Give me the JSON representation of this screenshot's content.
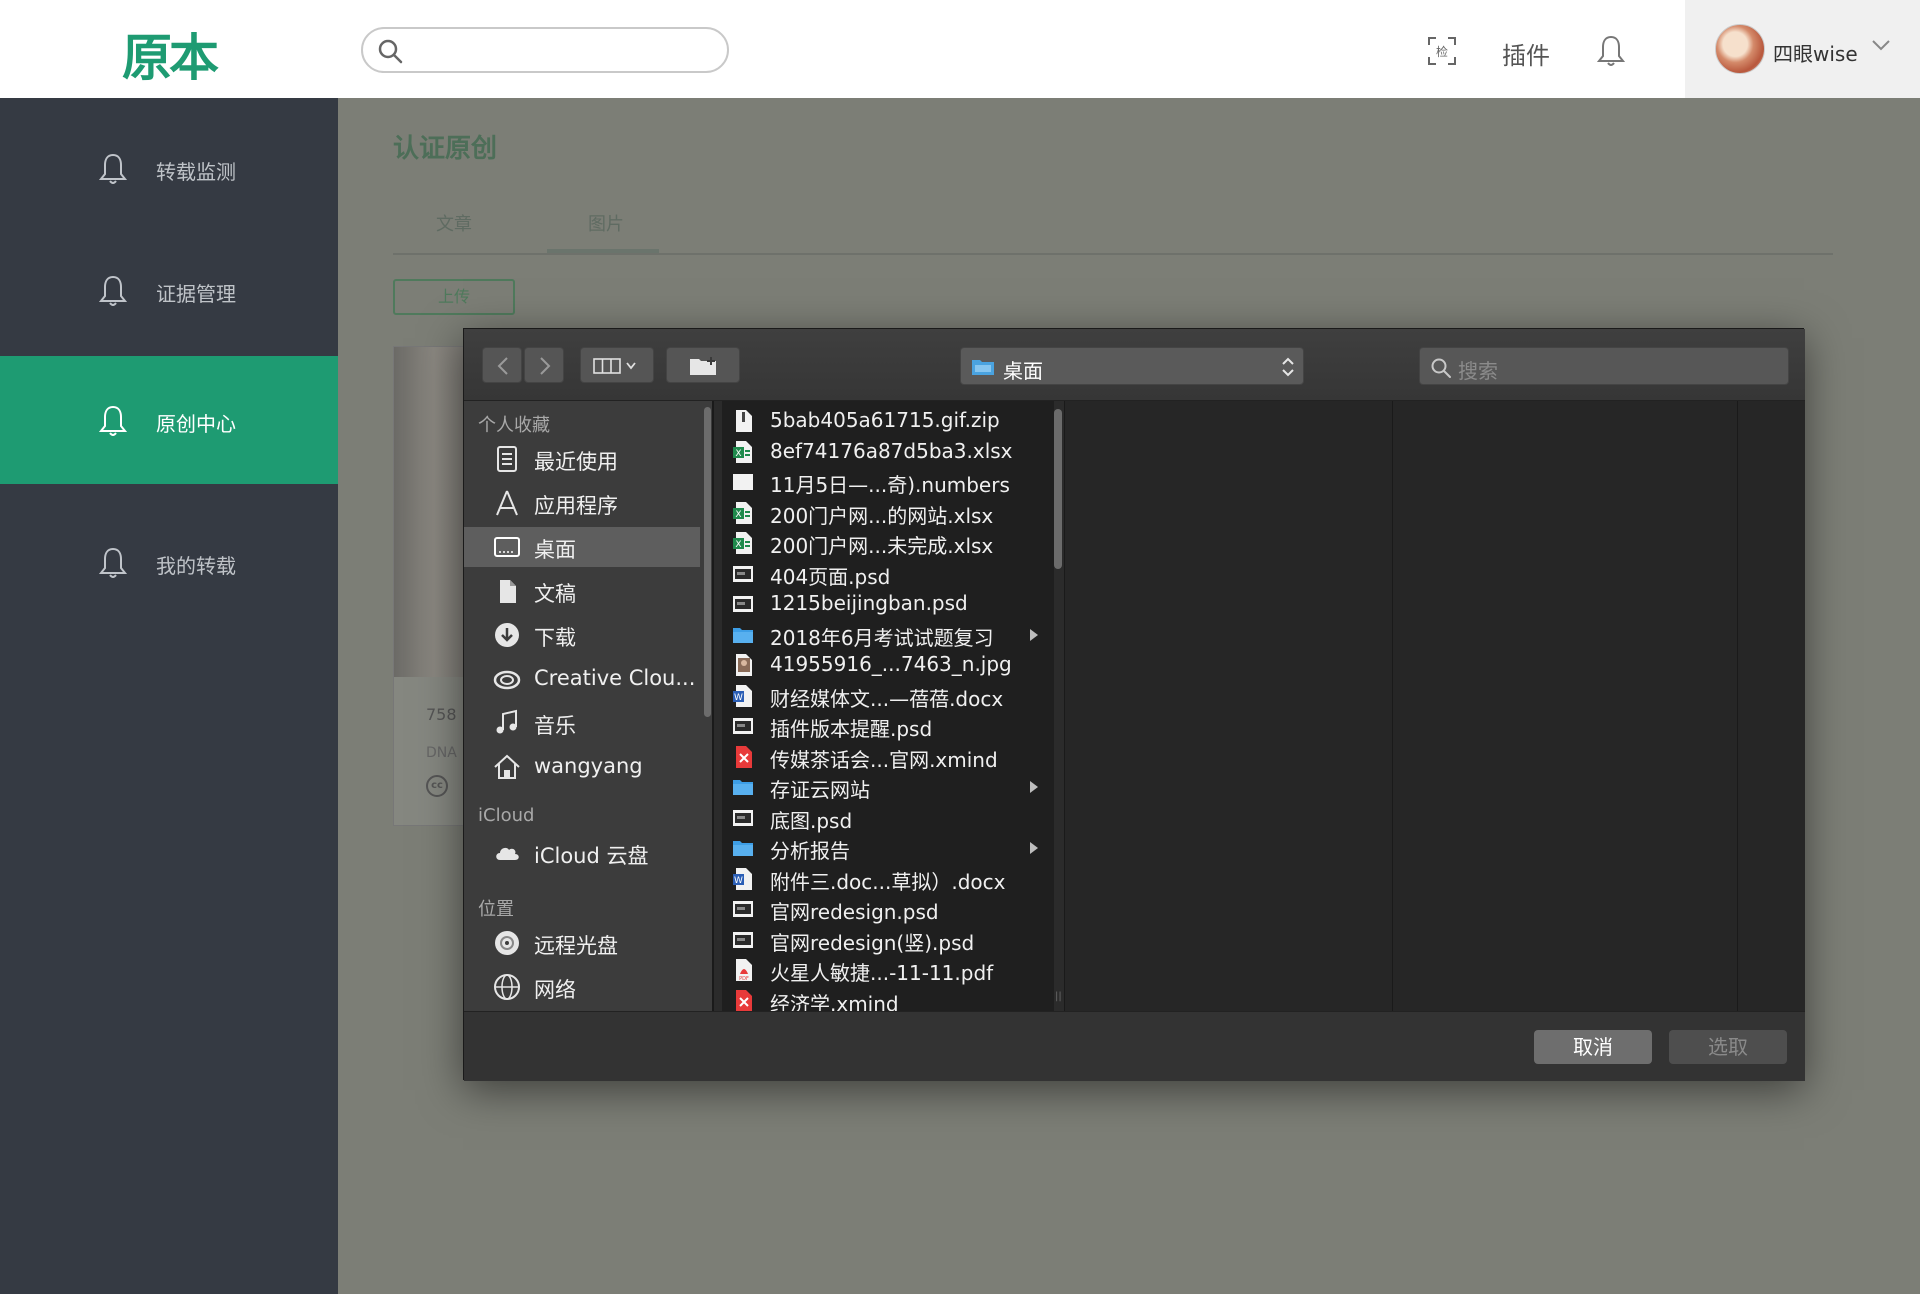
{
  "header": {
    "logo": "原本",
    "search_placeholder": "",
    "plugin_label": "插件",
    "user_name": "四眼wise"
  },
  "sidebar": {
    "items": [
      {
        "label": "转载监测"
      },
      {
        "label": "证据管理"
      },
      {
        "label": "原创中心",
        "active": true
      },
      {
        "label": "我的转载"
      }
    ]
  },
  "main": {
    "title": "认证原创",
    "tabs": [
      {
        "label": "文章"
      },
      {
        "label": "图片",
        "active": true
      }
    ],
    "upload_label": "上传",
    "card": {
      "number": "758",
      "dna": "DNA",
      "cc": "cc"
    }
  },
  "dialog": {
    "location": "桌面",
    "search_placeholder": "搜索",
    "sidebar": {
      "favorites_header": "个人收藏",
      "favorites": [
        {
          "label": "最近使用",
          "icon": "recents-icon"
        },
        {
          "label": "应用程序",
          "icon": "applications-icon"
        },
        {
          "label": "桌面",
          "icon": "desktop-icon",
          "selected": true
        },
        {
          "label": "文稿",
          "icon": "documents-icon"
        },
        {
          "label": "下载",
          "icon": "downloads-icon"
        },
        {
          "label": "Creative Clou...",
          "icon": "creative-cloud-icon"
        },
        {
          "label": "音乐",
          "icon": "music-icon"
        },
        {
          "label": "wangyang",
          "icon": "home-icon"
        }
      ],
      "icloud_header": "iCloud",
      "icloud": [
        {
          "label": "iCloud 云盘",
          "icon": "cloud-icon"
        }
      ],
      "locations_header": "位置",
      "locations": [
        {
          "label": "远程光盘",
          "icon": "disc-icon"
        },
        {
          "label": "网络",
          "icon": "network-icon"
        }
      ]
    },
    "files": [
      {
        "name": "5bab405a61715.gif.zip",
        "type": "zip"
      },
      {
        "name": "8ef74176a87d5ba3.xlsx",
        "type": "xlsx"
      },
      {
        "name": "11月5日—...奇).numbers",
        "type": "numbers"
      },
      {
        "name": "200门户网...的网站.xlsx",
        "type": "xlsx"
      },
      {
        "name": "200门户网...未完成.xlsx",
        "type": "xlsx"
      },
      {
        "name": "404页面.psd",
        "type": "psd"
      },
      {
        "name": "1215beijingban.psd",
        "type": "psd"
      },
      {
        "name": "2018年6月考试试题复习",
        "type": "folder"
      },
      {
        "name": "41955916_...7463_n.jpg",
        "type": "jpg"
      },
      {
        "name": "财经媒体文...—蓓蓓.docx",
        "type": "docx"
      },
      {
        "name": "插件版本提醒.psd",
        "type": "psd"
      },
      {
        "name": "传媒茶话会...官网.xmind",
        "type": "xmind"
      },
      {
        "name": "存证云网站",
        "type": "folder"
      },
      {
        "name": "底图.psd",
        "type": "psd"
      },
      {
        "name": "分析报告",
        "type": "folder"
      },
      {
        "name": "附件三.doc...草拟）.docx",
        "type": "docx"
      },
      {
        "name": "官网redesign.psd",
        "type": "psd"
      },
      {
        "name": "官网redesign(竖).psd",
        "type": "psd"
      },
      {
        "name": "火星人敏捷...-11-11.pdf",
        "type": "pdf"
      },
      {
        "name": "经济学.xmind",
        "type": "xmind"
      }
    ],
    "cancel_label": "取消",
    "choose_label": "选取"
  }
}
